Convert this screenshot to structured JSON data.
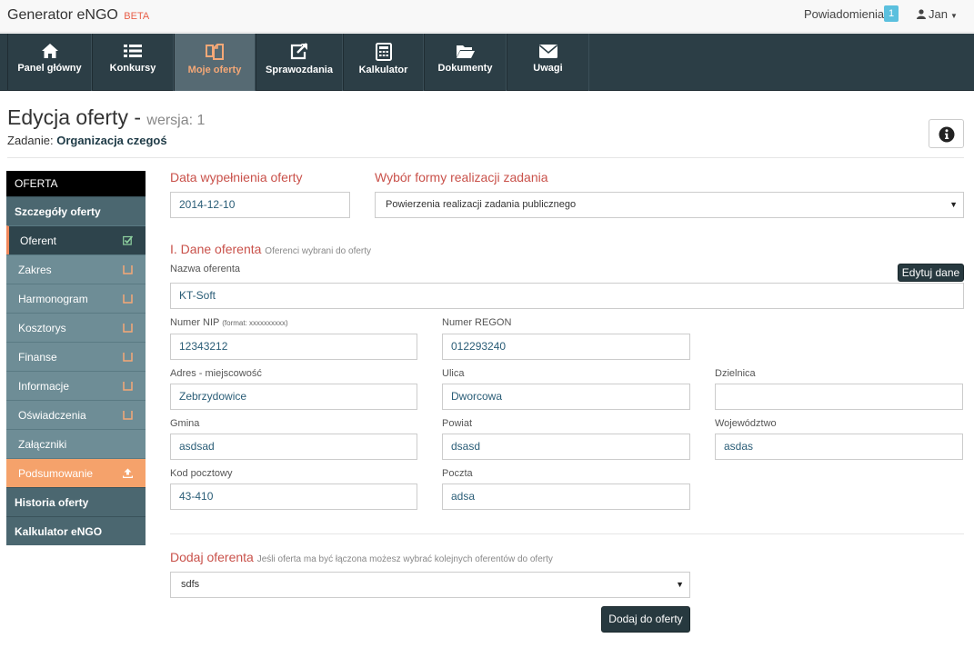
{
  "app": {
    "name": "Generator eNGO",
    "badge": "BETA"
  },
  "topbar": {
    "notifications_label": "Powiadomienia",
    "notifications_count": "1",
    "user_name": "Jan"
  },
  "nav": [
    {
      "label": "Panel główny",
      "icon": "home-icon"
    },
    {
      "label": "Konkursy",
      "icon": "list-icon"
    },
    {
      "label": "Moje oferty",
      "icon": "copy-icon",
      "active": true
    },
    {
      "label": "Sprawozdania",
      "icon": "external-link-icon"
    },
    {
      "label": "Kalkulator",
      "icon": "calculator-icon"
    },
    {
      "label": "Dokumenty",
      "icon": "folder-icon"
    },
    {
      "label": "Uwagi",
      "icon": "envelope-icon"
    }
  ],
  "page": {
    "title": "Edycja oferty -",
    "version_label": "wersja: 1",
    "task_label": "Zadanie:",
    "task_value": "Organizacja czegoś"
  },
  "sidebar": {
    "header": "OFERTA",
    "group1": "Szczegóły oferty",
    "items": [
      {
        "label": "Oferent",
        "status": "checked"
      },
      {
        "label": "Zakres",
        "status": "empty"
      },
      {
        "label": "Harmonogram",
        "status": "empty"
      },
      {
        "label": "Kosztorys",
        "status": "empty"
      },
      {
        "label": "Finanse",
        "status": "empty"
      },
      {
        "label": "Informacje",
        "status": "empty"
      },
      {
        "label": "Oświadczenia",
        "status": "empty"
      },
      {
        "label": "Załączniki",
        "status": "none"
      },
      {
        "label": "Podsumowanie",
        "status": "upload"
      }
    ],
    "group2": "Historia oferty",
    "group3": "Kalkulator eNGO"
  },
  "form": {
    "date_label": "Data wypełnienia oferty",
    "date_value": "2014-12-10",
    "form_type_label": "Wybór formy realizacji zadania",
    "form_type_value": "Powierzenia realizacji zadania publicznego",
    "section1_title": "I. Dane oferenta",
    "section1_note": "Oferenci wybrani do oferty",
    "edit_button": "Edytuj dane",
    "name_label": "Nazwa oferenta",
    "name_value": "KT-Soft",
    "nip_label": "Numer NIP",
    "nip_format": "(format: xxxxxxxxxx)",
    "nip_value": "12343212",
    "regon_label": "Numer REGON",
    "regon_value": "012293240",
    "city_label": "Adres - miejscowość",
    "city_value": "Zebrzydowice",
    "street_label": "Ulica",
    "street_value": "Dworcowa",
    "district_label": "Dzielnica",
    "district_value": "",
    "gmina_label": "Gmina",
    "gmina_value": "asdsad",
    "powiat_label": "Powiat",
    "powiat_value": "dsasd",
    "woj_label": "Województwo",
    "woj_value": "asdas",
    "zip_label": "Kod pocztowy",
    "zip_value": "43-410",
    "post_label": "Poczta",
    "post_value": "adsa",
    "add_title": "Dodaj oferenta",
    "add_note": "Jeśli oferta ma być łączona możesz wybrać kolejnych oferentów do oferty",
    "add_select_value": "sdfs",
    "add_button": "Dodaj do oferty"
  },
  "colors": {
    "nav_bg": "#2c3e46",
    "active_nav_text": "#f5a877",
    "section_title": "#c9514a",
    "sidebar_accent": "#f0875a",
    "badge": "#5bc0de"
  }
}
